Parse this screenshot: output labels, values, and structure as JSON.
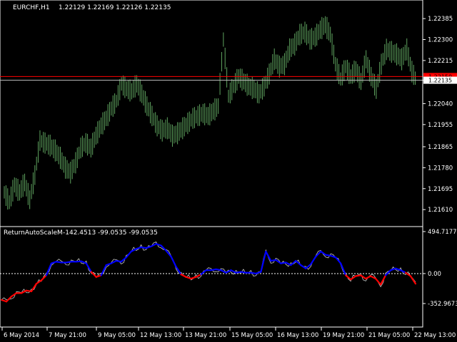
{
  "main_chart": {
    "symbol": "EURCHF,H1",
    "ohlc_text": "1.22129 1.22169 1.22126 1.22135",
    "price_ticks": [
      "1.22385",
      "1.22300",
      "1.22215",
      "1.22135",
      "1.22040",
      "1.21955",
      "1.21865",
      "1.21780",
      "1.21695",
      "1.21610"
    ],
    "bid_label": "1.22135",
    "red_line_label": "1.22150",
    "colors": {
      "bars": "#5fa35f",
      "bid_line": "#c0c0c0",
      "red_line": "#ff0000",
      "background": "#000000",
      "axis": "#ffffff"
    }
  },
  "indicator": {
    "title": "ReturnAutoScaleM",
    "values_text": "-142.4513 -99.0535 -99.0535",
    "scale_ticks": [
      "494.7177",
      "0.00",
      "-352.9673"
    ],
    "colors": {
      "raw_line": "#c8c8c8",
      "up": "#0000ff",
      "down": "#ff0000",
      "zero_line": "#ffffff"
    }
  },
  "time_axis": {
    "labels": [
      "6 May 2014",
      "7 May 21:00",
      "9 May 05:00",
      "12 May 13:00",
      "13 May 21:00",
      "15 May 05:00",
      "16 May 13:00",
      "19 May 21:00",
      "21 May 05:00",
      "22 May 13:00"
    ]
  },
  "chart_data": [
    {
      "type": "line",
      "title": "EURCHF,H1",
      "note": "price path approximated from OHLC bars",
      "ylim": [
        1.2157,
        1.2242
      ],
      "x_labels": [
        "6 May 2014",
        "7 May 21:00",
        "9 May 05:00",
        "12 May 13:00",
        "13 May 21:00",
        "15 May 05:00",
        "16 May 13:00",
        "19 May 21:00",
        "21 May 05:00",
        "22 May 13:00"
      ],
      "series": [
        {
          "values": [
            1.2168,
            1.2164,
            1.2171,
            1.2168,
            1.2172,
            1.2165,
            1.2175,
            1.2189,
            1.2188,
            1.2187,
            1.2185,
            1.2182,
            1.2178,
            1.2176,
            1.218,
            1.2186,
            1.2188,
            1.2186,
            1.2191,
            1.2195,
            1.2198,
            1.2202,
            1.2205,
            1.2212,
            1.221,
            1.2209,
            1.2212,
            1.2208,
            1.2203,
            1.2199,
            1.2195,
            1.2193,
            1.2194,
            1.2191,
            1.2192,
            1.2194,
            1.2196,
            1.2198,
            1.2199,
            1.22,
            1.2199,
            1.2201,
            1.2203,
            1.223,
            1.2207,
            1.2211,
            1.2215,
            1.2213,
            1.2211,
            1.221,
            1.2208,
            1.2211,
            1.2216,
            1.2222,
            1.2219,
            1.222,
            1.2226,
            1.2228,
            1.2232,
            1.2233,
            1.223,
            1.2231,
            1.2234,
            1.2236,
            1.2232,
            1.222,
            1.2214,
            1.2219,
            1.2215,
            1.2218,
            1.2213,
            1.2222,
            1.2215,
            1.221,
            1.222,
            1.2226,
            1.2225,
            1.2224,
            1.2222,
            1.2226,
            1.2217,
            1.2213
          ]
        }
      ]
    },
    {
      "type": "line",
      "title": "ReturnAutoScaleM",
      "ylim": [
        -352.9673,
        494.7177
      ],
      "x_labels": [
        "6 May 2014",
        "7 May 21:00",
        "9 May 05:00",
        "12 May 13:00",
        "13 May 21:00",
        "15 May 05:00",
        "16 May 13:00",
        "19 May 21:00",
        "21 May 05:00",
        "22 May 13:00"
      ],
      "series": [
        {
          "values": [
            -310,
            -330,
            -270,
            -230,
            -230,
            -200,
            -210,
            -120,
            -80,
            -20,
            120,
            140,
            130,
            130,
            140,
            140,
            145,
            120,
            20,
            -40,
            -20,
            100,
            120,
            150,
            140,
            190,
            260,
            290,
            310,
            300,
            320,
            350,
            330,
            270,
            200,
            80,
            -10,
            -40,
            -60,
            -40,
            -10,
            40,
            40,
            50,
            40,
            10,
            40,
            10,
            20,
            10,
            10,
            0,
            20,
            260,
            150,
            160,
            120,
            130,
            100,
            150,
            100,
            60,
            110,
            200,
            260,
            220,
            210,
            190,
            120,
            -20,
            -70,
            -30,
            -20,
            -60,
            -30,
            -60,
            -130,
            -20,
            40,
            60,
            40,
            10,
            -30,
            -120
          ]
        }
      ]
    }
  ]
}
